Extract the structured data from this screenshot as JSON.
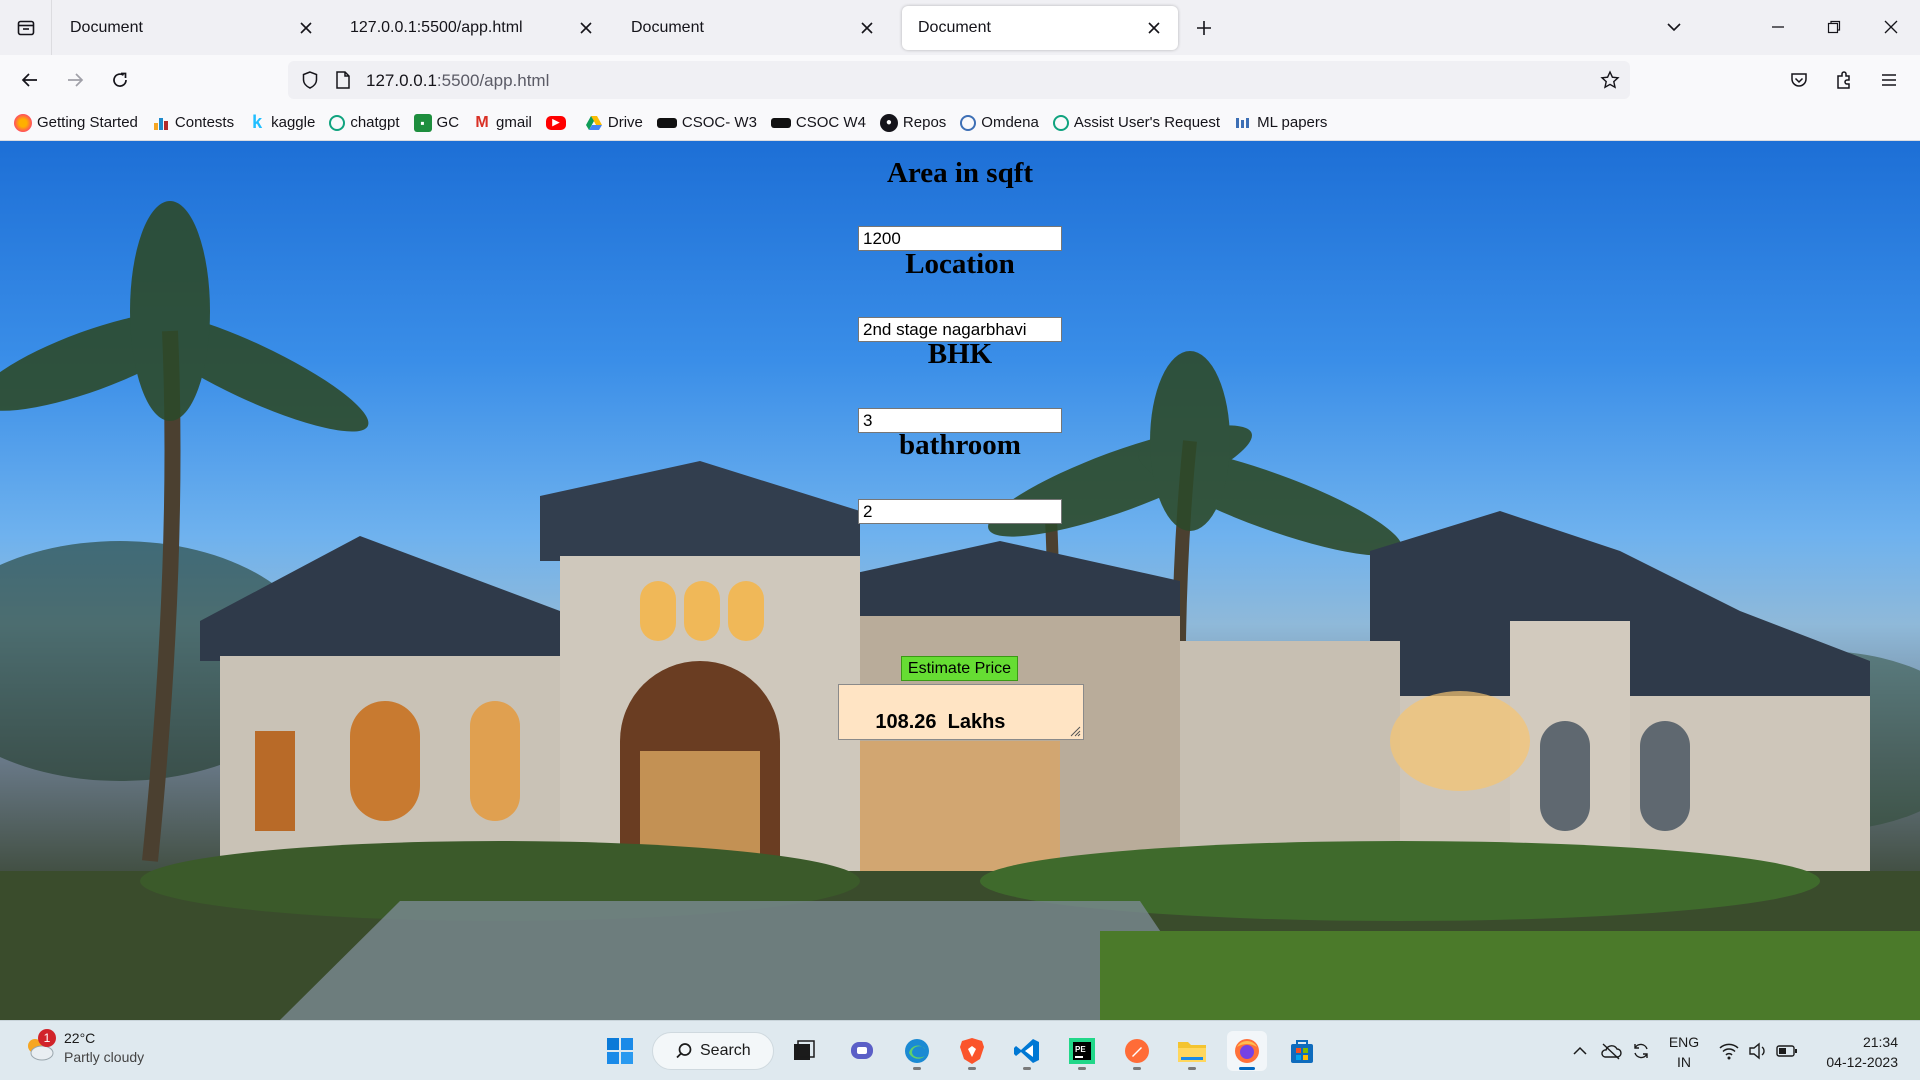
{
  "browser": {
    "tabs": [
      {
        "title": "Document",
        "active": false
      },
      {
        "title": "127.0.0.1:5500/app.html",
        "active": false
      },
      {
        "title": "Document",
        "active": false
      },
      {
        "title": "Document",
        "active": true
      }
    ],
    "url": {
      "host": "127.0.0.1",
      "path": ":5500/app.html"
    },
    "bookmarks": [
      {
        "label": "Getting Started",
        "icon": "firefox-icon"
      },
      {
        "label": "Contests",
        "icon": "chart-icon"
      },
      {
        "label": "kaggle",
        "icon": "kaggle-icon"
      },
      {
        "label": "chatgpt",
        "icon": "chatgpt-icon"
      },
      {
        "label": "GC",
        "icon": "classroom-icon"
      },
      {
        "label": "gmail",
        "icon": "gmail-icon"
      },
      {
        "label": "",
        "icon": "youtube-icon"
      },
      {
        "label": "Drive",
        "icon": "drive-icon"
      },
      {
        "label": "CSOC- W3",
        "icon": "csoc-icon"
      },
      {
        "label": "CSOC W4",
        "icon": "csoc-icon"
      },
      {
        "label": "Repos",
        "icon": "github-icon"
      },
      {
        "label": "Omdena",
        "icon": "omdena-icon"
      },
      {
        "label": "Assist User's Request",
        "icon": "chatgpt-icon"
      },
      {
        "label": "ML papers",
        "icon": "papers-icon"
      }
    ]
  },
  "form": {
    "area_label": "Area in sqft",
    "area_value": "1200",
    "location_label": "Location",
    "location_value": "2nd stage nagarbhavi",
    "bhk_label": "BHK",
    "bhk_value": "3",
    "bathroom_label": "bathroom",
    "bathroom_value": "2",
    "estimate_button": "Estimate Price",
    "result": "108.26  Lakhs"
  },
  "taskbar": {
    "weather_badge": "1",
    "temperature": "22°C",
    "condition": "Partly cloudy",
    "search_label": "Search",
    "lang_line1": "ENG",
    "lang_line2": "IN",
    "time": "21:34",
    "date": "04-12-2023"
  },
  "colors": {
    "estimate_button": "#66dd33",
    "result_box": "#ffe4c4",
    "taskbar": "#dfe9ef"
  }
}
